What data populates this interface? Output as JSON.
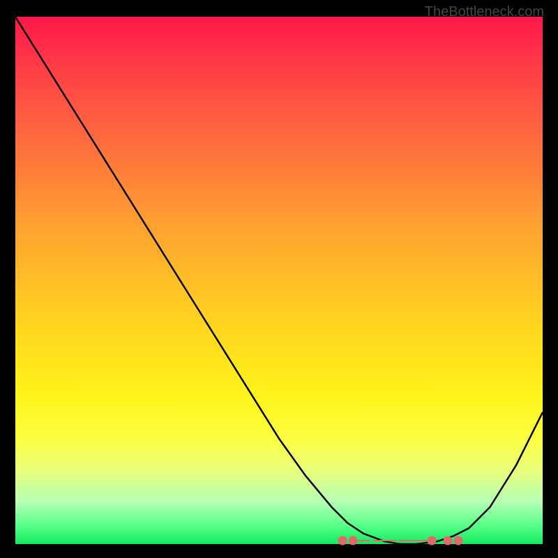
{
  "watermark": "TheBottleneck.com",
  "chart_data": {
    "type": "line",
    "title": "",
    "xlabel": "",
    "ylabel": "",
    "xlim": [
      0,
      100
    ],
    "ylim": [
      0,
      100
    ],
    "series": [
      {
        "name": "bottleneck-curve",
        "x": [
          0,
          5,
          10,
          15,
          20,
          25,
          30,
          35,
          40,
          45,
          50,
          55,
          60,
          63,
          66,
          70,
          73,
          76,
          80,
          83,
          86,
          90,
          95,
          100
        ],
        "y": [
          100,
          92,
          84,
          76,
          68,
          60,
          52,
          44,
          36,
          28,
          20,
          13,
          7,
          4,
          2,
          0.5,
          0,
          0,
          0.5,
          1.5,
          3,
          7,
          15,
          25
        ]
      }
    ],
    "optimal_marker": {
      "dots_x": [
        62,
        64,
        79,
        82,
        84
      ],
      "dash_x": [
        66,
        69,
        71,
        74,
        76,
        78
      ],
      "y": 0.7
    }
  }
}
